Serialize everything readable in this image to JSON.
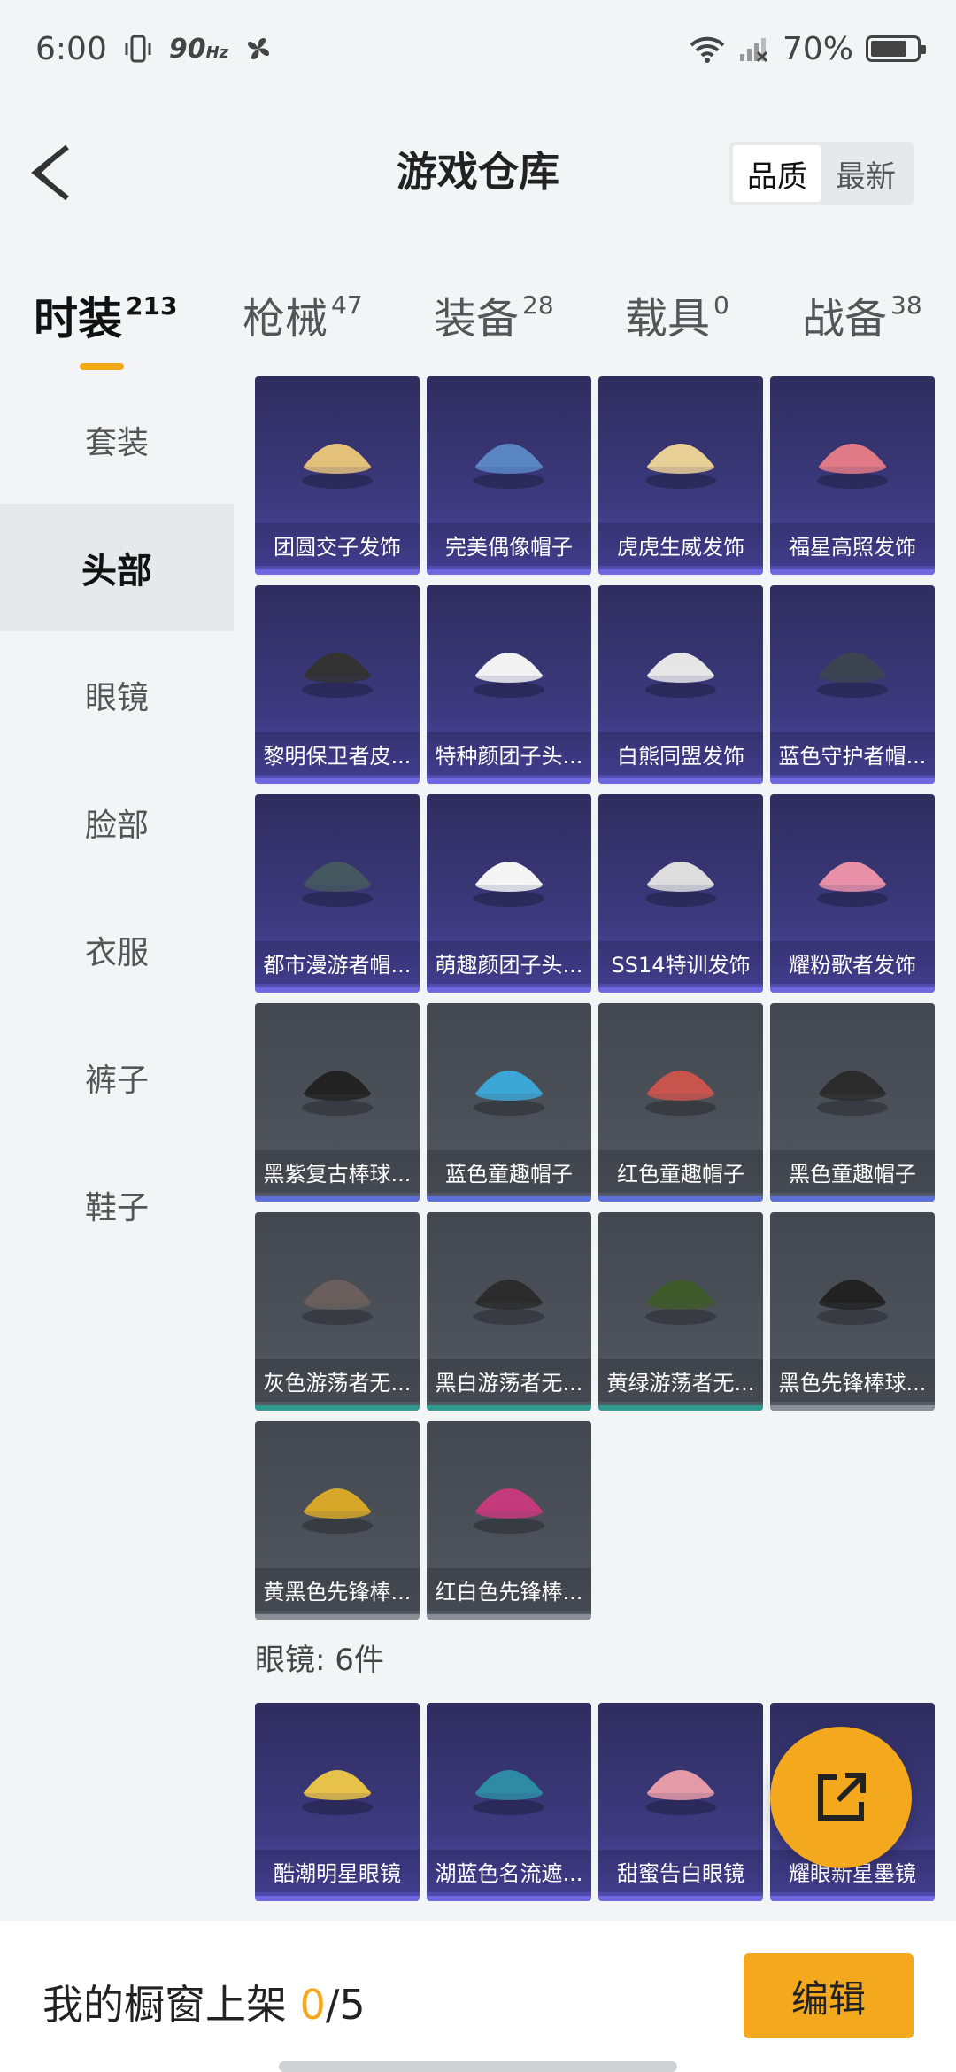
{
  "status": {
    "time": "6:00",
    "refresh": "90",
    "refresh_unit": "Hz",
    "battery": "70%"
  },
  "header": {
    "title": "游戏仓库",
    "sort_options": [
      "品质",
      "最新"
    ],
    "sort_active": 0
  },
  "tabs": [
    {
      "label": "时装",
      "count": "213",
      "active": true
    },
    {
      "label": "枪械",
      "count": "47"
    },
    {
      "label": "装备",
      "count": "28"
    },
    {
      "label": "载具",
      "count": "0"
    },
    {
      "label": "战备",
      "count": "38"
    }
  ],
  "sidebar": [
    "套装",
    "头部",
    "眼镜",
    "脸部",
    "衣服",
    "裤子",
    "鞋子"
  ],
  "sidebar_active": 1,
  "head_items": [
    "团圆交子发饰",
    "完美偶像帽子",
    "虎虎生威发饰",
    "福星高照发饰",
    "黎明保卫者皮...",
    "特种颜团子头...",
    "白熊同盟发饰",
    "蓝色守护者帽...",
    "都市漫游者帽...",
    "萌趣颜团子头...",
    "SS14特训发饰",
    "耀粉歌者发饰",
    "黑紫复古棒球...",
    "蓝色童趣帽子",
    "红色童趣帽子",
    "黑色童趣帽子",
    "灰色游荡者无...",
    "黑白游荡者无...",
    "黄绿游荡者无...",
    "黑色先锋棒球...",
    "黄黑色先锋棒...",
    "红白色先锋棒..."
  ],
  "glasses_section": "眼镜: 6件",
  "glasses_items": [
    "酷潮明星眼镜",
    "湖蓝色名流遮...",
    "甜蜜告白眼镜",
    "耀眼新星墨镜"
  ],
  "bottom": {
    "label": "我的橱窗上架",
    "count": "0",
    "total": "/5",
    "edit": "编辑"
  }
}
